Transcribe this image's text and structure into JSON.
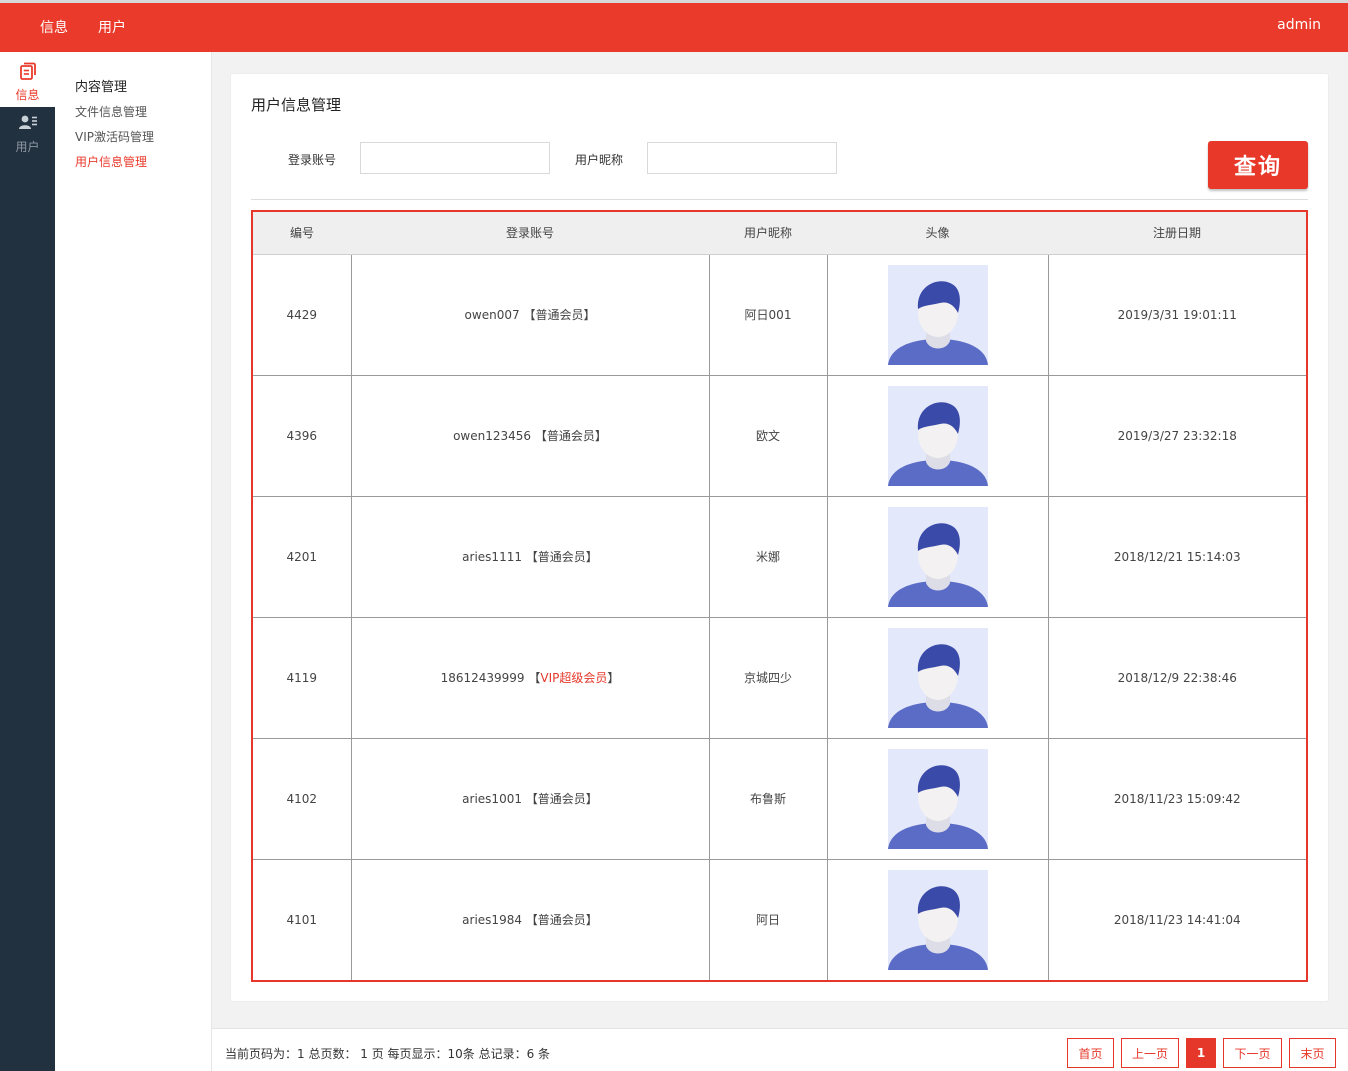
{
  "topbar": {
    "nav": [
      "信息",
      "用户"
    ],
    "user": "admin"
  },
  "rail": [
    {
      "label": "信息",
      "icon": "document-icon",
      "active": true
    },
    {
      "label": "用户",
      "icon": "user-list-icon",
      "active": false
    }
  ],
  "submenu": {
    "group": "内容管理",
    "items": [
      "文件信息管理",
      "VIP激活码管理",
      "用户信息管理"
    ],
    "active_index": 2
  },
  "page": {
    "title": "用户信息管理",
    "search": {
      "account_label": "登录账号",
      "account_value": "",
      "nickname_label": "用户昵称",
      "nickname_value": ""
    },
    "query_button": "查询"
  },
  "table": {
    "headers": [
      "编号",
      "登录账号",
      "用户昵称",
      "头像",
      "注册日期"
    ],
    "rows": [
      {
        "id": "4429",
        "account": "owen007",
        "level": "【普通会员】",
        "vip": false,
        "nickname": "阿日001",
        "date": "2019/3/31 19:01:11"
      },
      {
        "id": "4396",
        "account": "owen123456",
        "level": "【普通会员】",
        "vip": false,
        "nickname": "欧文",
        "date": "2019/3/27 23:32:18"
      },
      {
        "id": "4201",
        "account": "aries1111",
        "level": "【普通会员】",
        "vip": false,
        "nickname": "米娜",
        "date": "2018/12/21 15:14:03"
      },
      {
        "id": "4119",
        "account": "18612439999",
        "level": "【VIP超级会员】",
        "vip": true,
        "nickname": "京城四少",
        "date": "2018/12/9 22:38:46"
      },
      {
        "id": "4102",
        "account": "aries1001",
        "level": "【普通会员】",
        "vip": false,
        "nickname": "布鲁斯",
        "date": "2018/11/23 15:09:42"
      },
      {
        "id": "4101",
        "account": "aries1984",
        "level": "【普通会员】",
        "vip": false,
        "nickname": "阿日",
        "date": "2018/11/23 14:41:04"
      }
    ]
  },
  "footer": {
    "info": "当前页码为：1 总页数： 1 页 每页显示：10条 总记录：6 条",
    "pager": [
      "首页",
      "上一页",
      "1",
      "下一页",
      "末页"
    ],
    "current_page": "1"
  },
  "colors": {
    "primary": "#ea3a2b",
    "rail": "#22313f",
    "vip": "#e6382a"
  }
}
